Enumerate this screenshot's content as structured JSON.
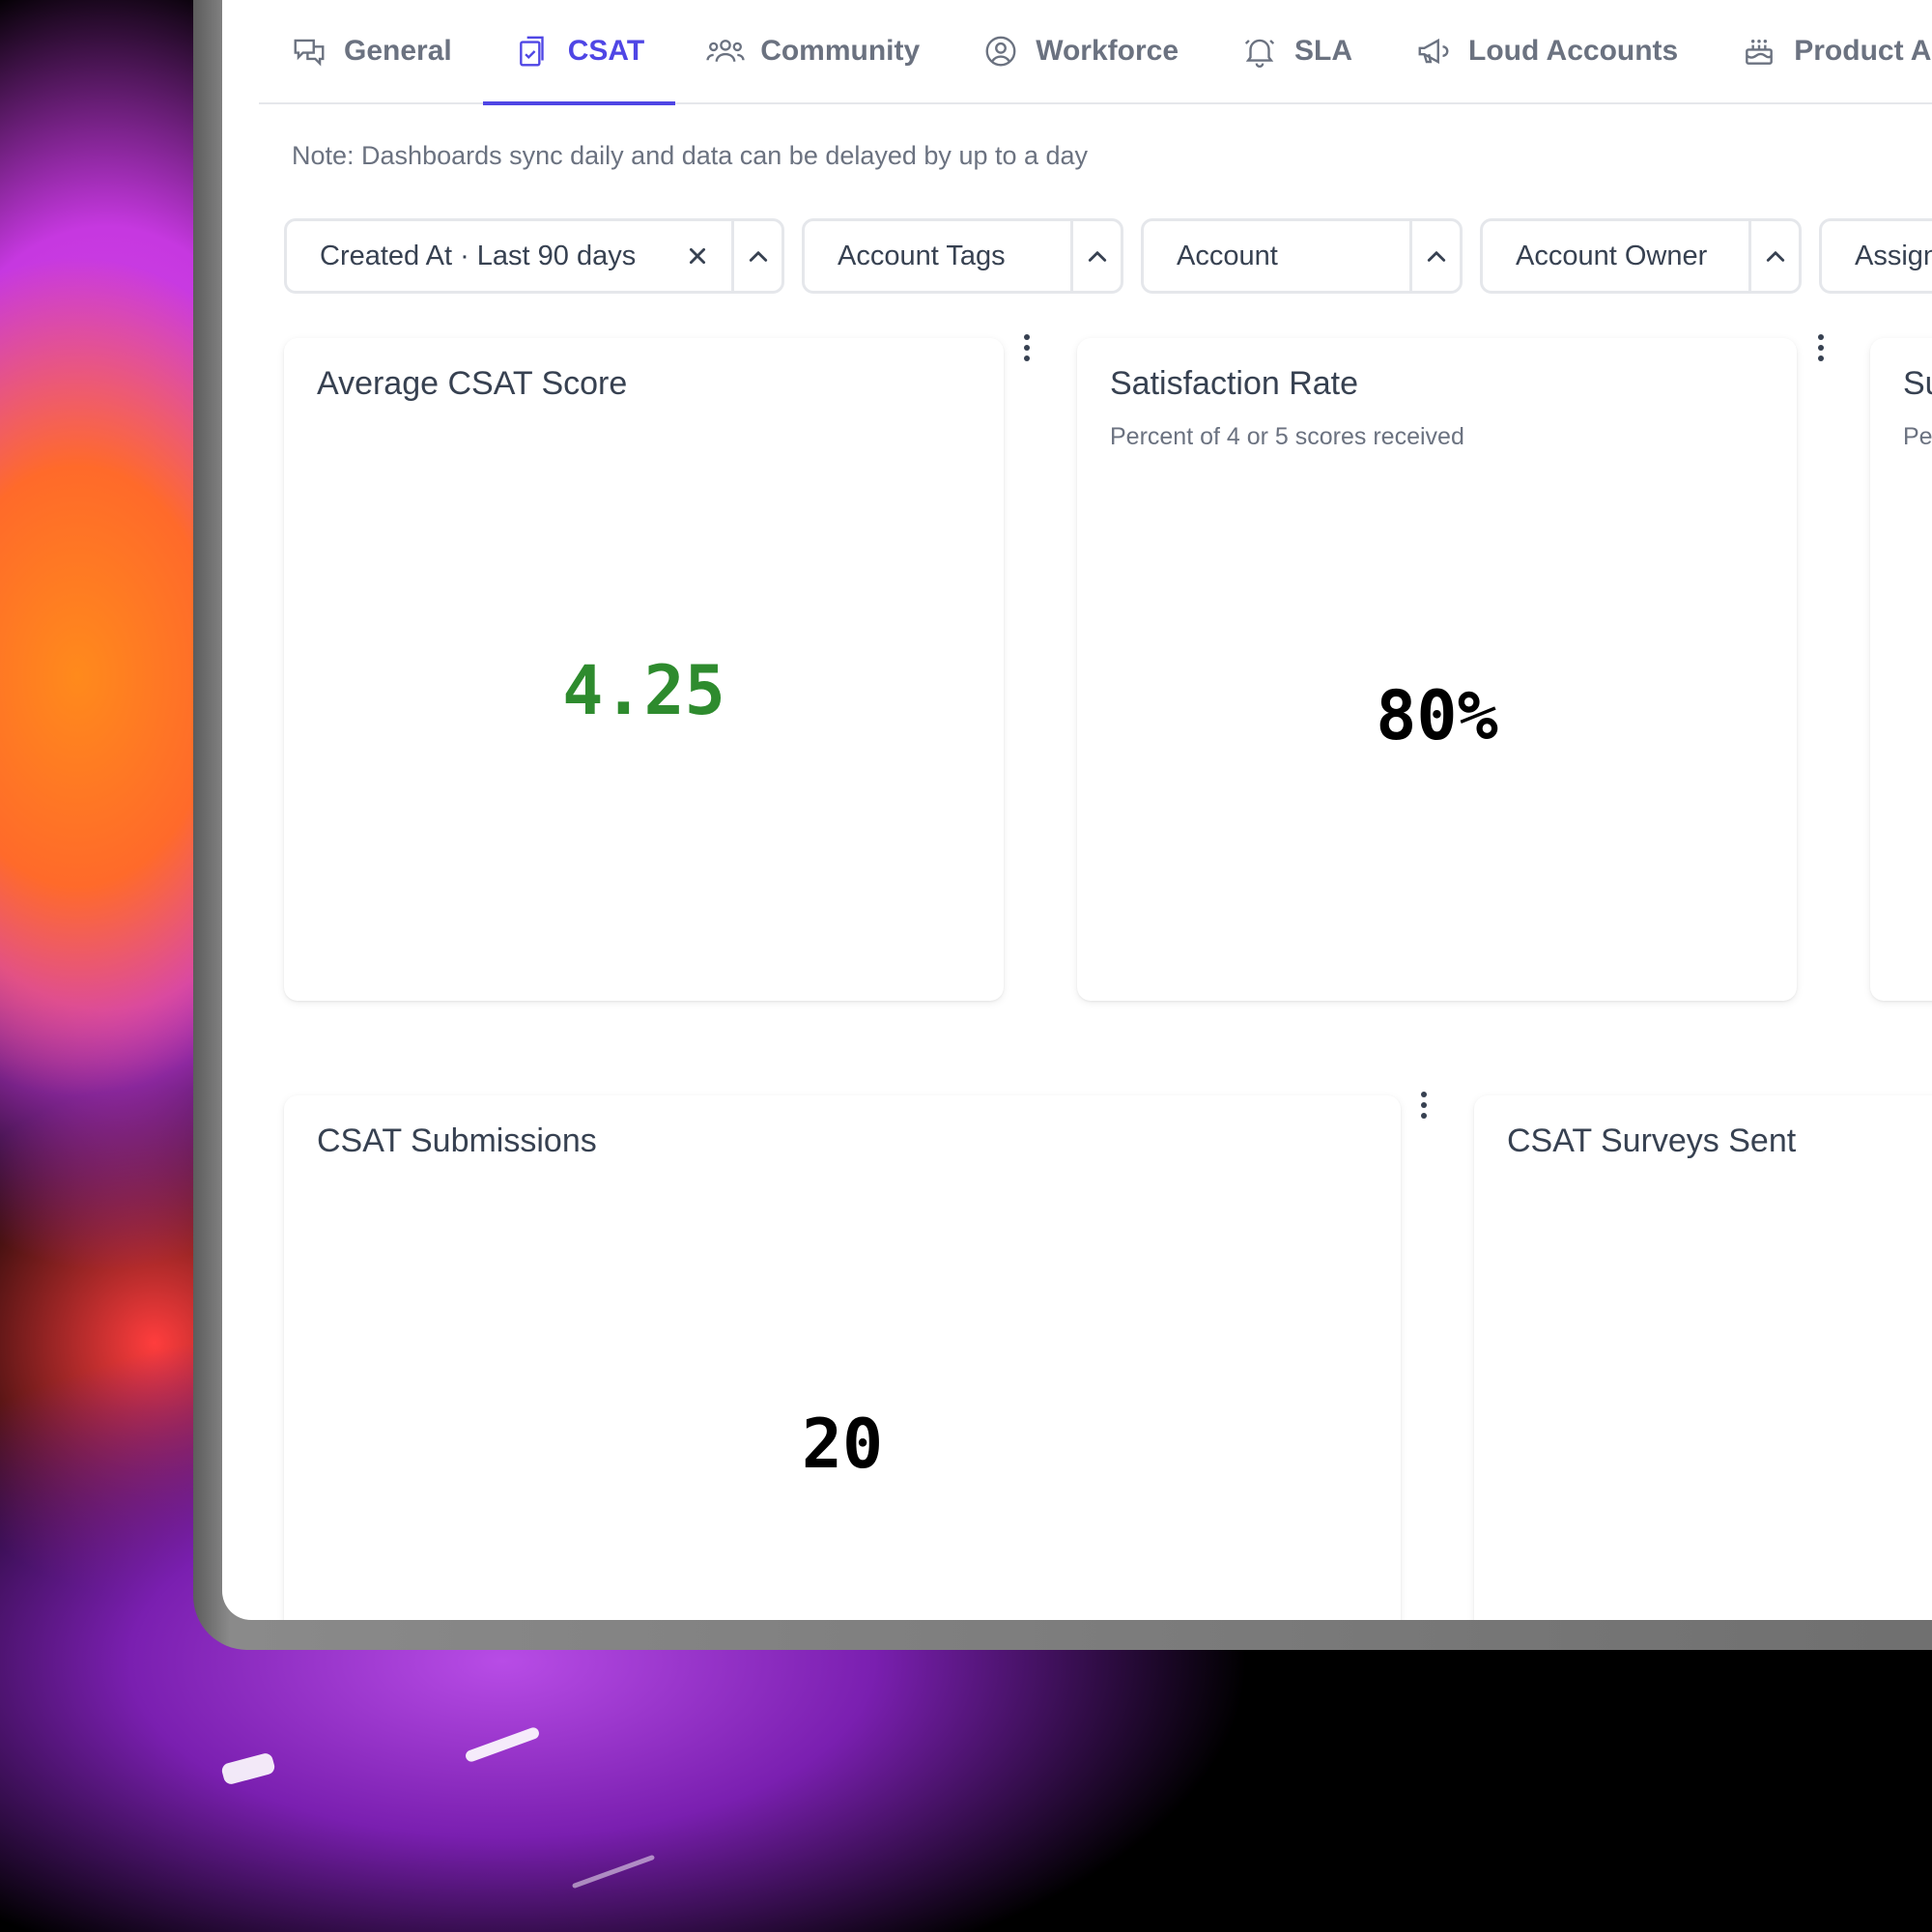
{
  "tabs": [
    {
      "label": "General",
      "icon": "chat-bubbles-icon",
      "active": false
    },
    {
      "label": "CSAT",
      "icon": "clipboard-check-icon",
      "active": true
    },
    {
      "label": "Community",
      "icon": "users-icon",
      "active": false
    },
    {
      "label": "Workforce",
      "icon": "user-circle-icon",
      "active": false
    },
    {
      "label": "SLA",
      "icon": "bell-icon",
      "active": false
    },
    {
      "label": "Loud Accounts",
      "icon": "megaphone-icon",
      "active": false
    },
    {
      "label": "Product Area",
      "icon": "cake-icon",
      "active": false
    }
  ],
  "note": "Note: Dashboards sync daily and data can be delayed by up to a day",
  "filters": [
    {
      "label": "Created At · Last 90 days",
      "clearable": true
    },
    {
      "label": "Account Tags"
    },
    {
      "label": "Account"
    },
    {
      "label": "Account Owner"
    },
    {
      "label": "Assign"
    }
  ],
  "cards": {
    "avg_csat": {
      "title": "Average CSAT Score",
      "value": "4.25",
      "value_color": "#2e8b2e"
    },
    "satisfaction": {
      "title": "Satisfaction Rate",
      "subtitle": "Percent of 4 or 5 scores received",
      "value": "80%"
    },
    "partial": {
      "title": "Su",
      "subtitle": "Pe"
    },
    "submissions": {
      "title": "CSAT Submissions",
      "value": "20"
    },
    "surveys_sent": {
      "title": "CSAT Surveys Sent"
    }
  },
  "colors": {
    "accent": "#4f46e5",
    "positive": "#2e8b2e"
  }
}
